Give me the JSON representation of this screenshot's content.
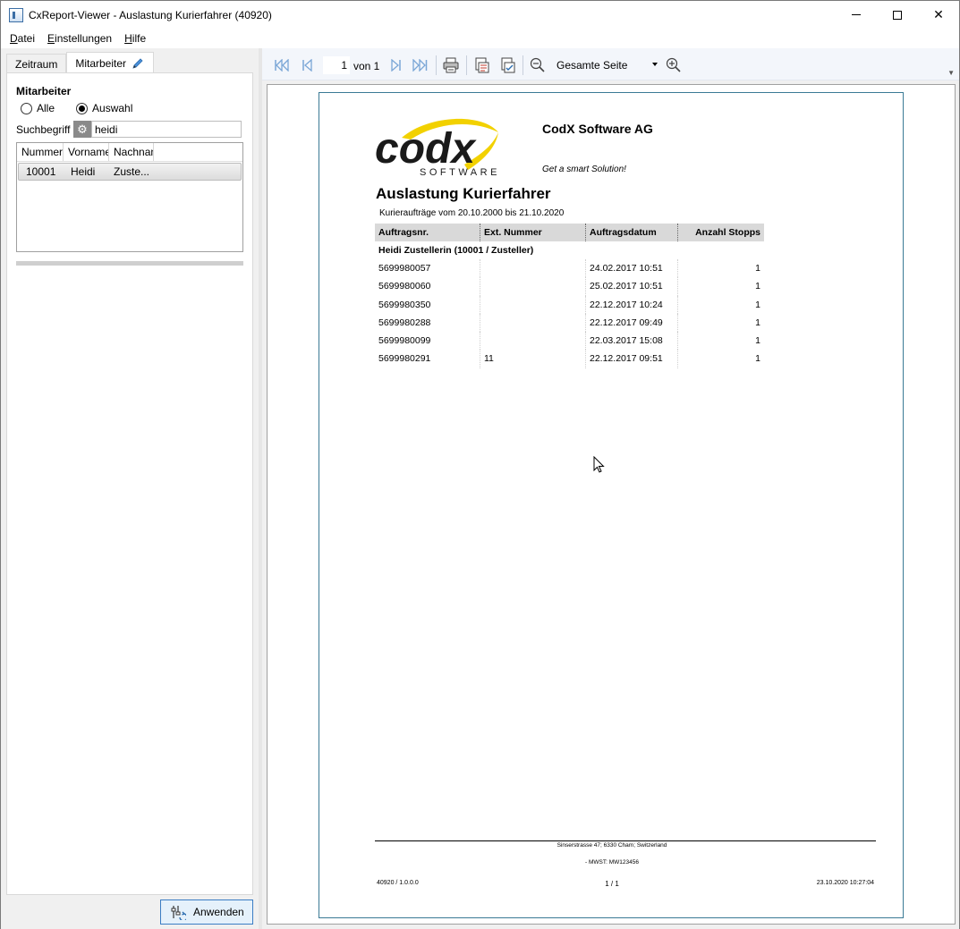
{
  "window": {
    "title": "CxReport-Viewer - Auslastung Kurierfahrer (40920)",
    "min_label": "",
    "close_label": "✕"
  },
  "menu": {
    "datei_u": "D",
    "datei_rest": "atei",
    "einst_u": "E",
    "einst_rest": "instellungen",
    "hilfe_u": "H",
    "hilfe_rest": "ilfe"
  },
  "tabs": {
    "zeitraum": "Zeitraum",
    "mitarbeiter": "Mitarbeiter"
  },
  "filter": {
    "section_title": "Mitarbeiter",
    "radio_all": "Alle",
    "radio_selection": "Auswahl",
    "search_label": "Suchbegriff",
    "search_value": "heidi"
  },
  "grid": {
    "headers": [
      "Nummer",
      "Vorname",
      "Nachnan"
    ],
    "rows": [
      {
        "nummer": "10001",
        "vorname": "Heidi",
        "nachname": "Zuste..."
      }
    ]
  },
  "apply_label": "Anwenden",
  "toolbar": {
    "page_current": "1",
    "page_of": "von 1",
    "zoom": "Gesamte Seite"
  },
  "report": {
    "company": "CodX Software AG",
    "slogan": "Get a smart Solution!",
    "logo_text": "codx",
    "logo_sub": "SOFTWARE",
    "title": "Auslastung Kurierfahrer",
    "subtitle": "Kurieraufträge vom 20.10.2000 bis 21.10.2020",
    "columns": [
      "Auftragsnr.",
      "Ext. Nummer",
      "Auftragsdatum",
      "Anzahl Stopps"
    ],
    "group": "Heidi Zustellerin (10001 / Zusteller)",
    "rows": [
      {
        "nr": "5699980057",
        "ext": "",
        "date": "24.02.2017 10:51",
        "stops": "1"
      },
      {
        "nr": "5699980060",
        "ext": "",
        "date": "25.02.2017 10:51",
        "stops": "1"
      },
      {
        "nr": "5699980350",
        "ext": "",
        "date": "22.12.2017 10:24",
        "stops": "1"
      },
      {
        "nr": "5699980288",
        "ext": "",
        "date": "22.12.2017 09:49",
        "stops": "1"
      },
      {
        "nr": "5699980099",
        "ext": "",
        "date": "22.03.2017 15:08",
        "stops": "1"
      },
      {
        "nr": "5699980291",
        "ext": "11",
        "date": "22.12.2017 09:51",
        "stops": "1"
      }
    ],
    "footer": {
      "address": "Sinserstrasse 47; 6330 Cham; Switzerland",
      "vat": "- MWST: MW123456",
      "left": "40920 / 1.0.0.0",
      "page": "1 / 1",
      "right": "23.10.2020 10:27:04"
    }
  },
  "colors": {
    "accent": "#3b7dc4",
    "page_border": "#3a7a95",
    "logo_yellow": "#f2d100",
    "header_gray": "#d9d9d9"
  }
}
